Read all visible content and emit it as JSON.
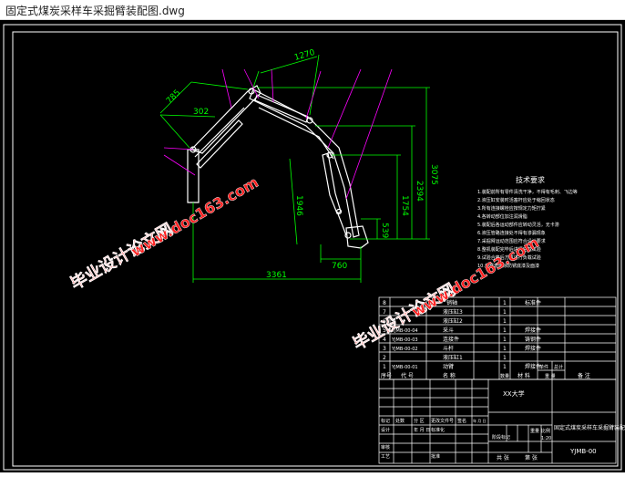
{
  "window": {
    "title": "固定式煤炭采样车采掘臂装配图.dwg"
  },
  "colors": {
    "background": "#000000",
    "frame": "#ffffff",
    "dimension": "#00ff00",
    "leader": "#ff00ff",
    "drawing": "#ffffff",
    "watermark": "#ff2020"
  },
  "dimensions": {
    "d1270": "1270",
    "d785": "785",
    "d302": "302",
    "d3075": "3075",
    "d2394": "2394",
    "d1754": "1754",
    "d1946": "1946",
    "d539": "539",
    "d760": "760",
    "d3361": "3361"
  },
  "tech_req": {
    "title": "技术要求",
    "lines": [
      "1.装配前所有零件清洗干净，不得有毛刺、飞边等",
      "2.液压缸安装时活塞杆应处于缩回状态",
      "3.所有连接螺栓应按规定力矩拧紧",
      "4.各转动部位加注润滑脂",
      "5.装配后各运动部件应转动灵活，无卡滞",
      "6.液压管路连接处不得有渗漏现象",
      "7.采掘臂运动范围应符合设计要求",
      "8.整机装配完毕后进行空载试验",
      "9.试验合格后方可进行负载试验",
      "10.外露表面涂防锈底漆及面漆"
    ]
  },
  "watermarks": {
    "brand": "毕业设计论文网",
    "url": "www.doc163.com"
  },
  "parts_list": {
    "rows": [
      {
        "no": "8",
        "code": "",
        "name": "销轴",
        "qty": "1",
        "remark": "标准件"
      },
      {
        "no": "7",
        "code": "",
        "name": "液压缸3",
        "qty": "1",
        "remark": ""
      },
      {
        "no": "6",
        "code": "",
        "name": "液压缸2",
        "qty": "1",
        "remark": ""
      },
      {
        "no": "5",
        "code": "YJMB-00-04",
        "name": "采斗",
        "qty": "1",
        "remark": "焊接件"
      },
      {
        "no": "4",
        "code": "YJMB-00-03",
        "name": "连接件",
        "qty": "1",
        "remark": "铸钢件"
      },
      {
        "no": "3",
        "code": "YJMB-00-02",
        "name": "斗杆",
        "qty": "1",
        "remark": "焊接件"
      },
      {
        "no": "2",
        "code": "",
        "name": "液压缸1",
        "qty": "1",
        "remark": ""
      },
      {
        "no": "1",
        "code": "YJMB-00-01",
        "name": "动臂",
        "qty": "1",
        "remark": "焊接件"
      }
    ],
    "header": {
      "no": "序号",
      "code": "代 号",
      "name": "名 称",
      "qty": "数量",
      "material": "材 料",
      "unit_weight": "单件",
      "total_weight": "总计",
      "weight": "重 量",
      "remark": "备 注"
    }
  },
  "title_block": {
    "school": "XX大学",
    "drawing_title": "固定式煤炭采样车采掘臂装配图",
    "drawing_no": "YJMB-00",
    "sheet_total": "共 张",
    "sheet_no": "第 张",
    "scale_label": "比例",
    "scale_value": "1:20",
    "weight_label": "重量",
    "stage_label": "阶段标记",
    "mark_label": "标记",
    "count_label": "处数",
    "zone_label": "分 区",
    "change_label": "更改文件号",
    "sign_label": "签名",
    "date_label": "年 月 日",
    "design_label": "设计",
    "std_label": "标准化",
    "review_label": "审核",
    "process_label": "工艺",
    "approve_label": "批准"
  }
}
